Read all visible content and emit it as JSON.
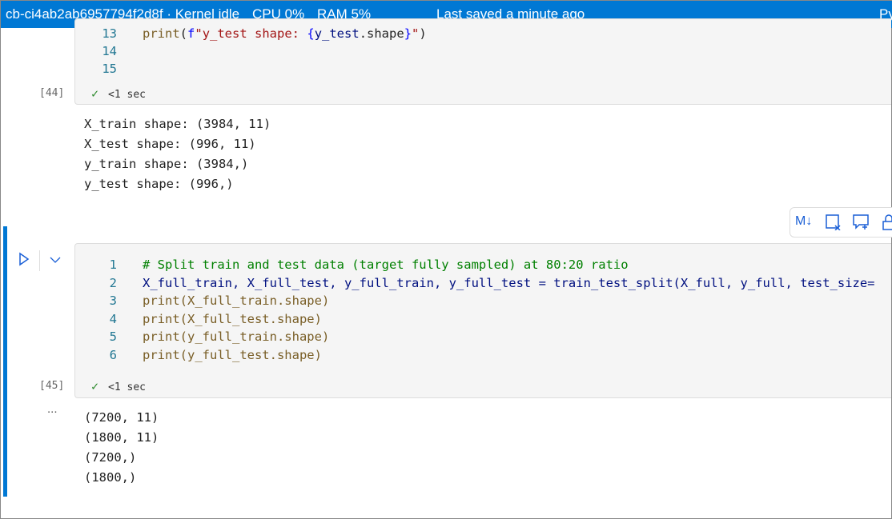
{
  "header": {
    "kernel": "cb-ci4ab2ab6957794f2d8f · Kernel idle",
    "cpu": "CPU  0%",
    "ram": "RAM  5%",
    "saved": "Last saved a minute ago",
    "right": "Py"
  },
  "cell44": {
    "count": "[44]",
    "status": "<1 sec",
    "lines": [
      {
        "n": "13",
        "code": "print(f\"y_test shape: {y_test.shape}\")"
      },
      {
        "n": "14",
        "code": ""
      },
      {
        "n": "15",
        "code": ""
      }
    ],
    "output": [
      "X_train shape: (3984, 11)",
      "X_test shape: (996, 11)",
      "y_train shape: (3984,)",
      "y_test shape: (996,)"
    ]
  },
  "toolbar": {
    "icons": [
      "markdown-icon",
      "clear-output-icon",
      "add-comment-icon",
      "lock-icon"
    ],
    "markdown": "M↓"
  },
  "cell45": {
    "count": "[45]",
    "status": "<1 sec",
    "more": "...",
    "lines": [
      {
        "n": "1",
        "code": "# Split train and test data (target fully sampled) at 80:20 ratio"
      },
      {
        "n": "2",
        "code": "X_full_train, X_full_test, y_full_train, y_full_test = train_test_split(X_full, y_full, test_size="
      },
      {
        "n": "3",
        "code": "print(X_full_train.shape)"
      },
      {
        "n": "4",
        "code": "print(X_full_test.shape)"
      },
      {
        "n": "5",
        "code": "print(y_full_train.shape)"
      },
      {
        "n": "6",
        "code": "print(y_full_test.shape)"
      }
    ],
    "output": [
      "(7200, 11)",
      "(1800, 11)",
      "(7200,)",
      "(1800,)"
    ]
  },
  "colors": {
    "accent": "#0078d4"
  }
}
